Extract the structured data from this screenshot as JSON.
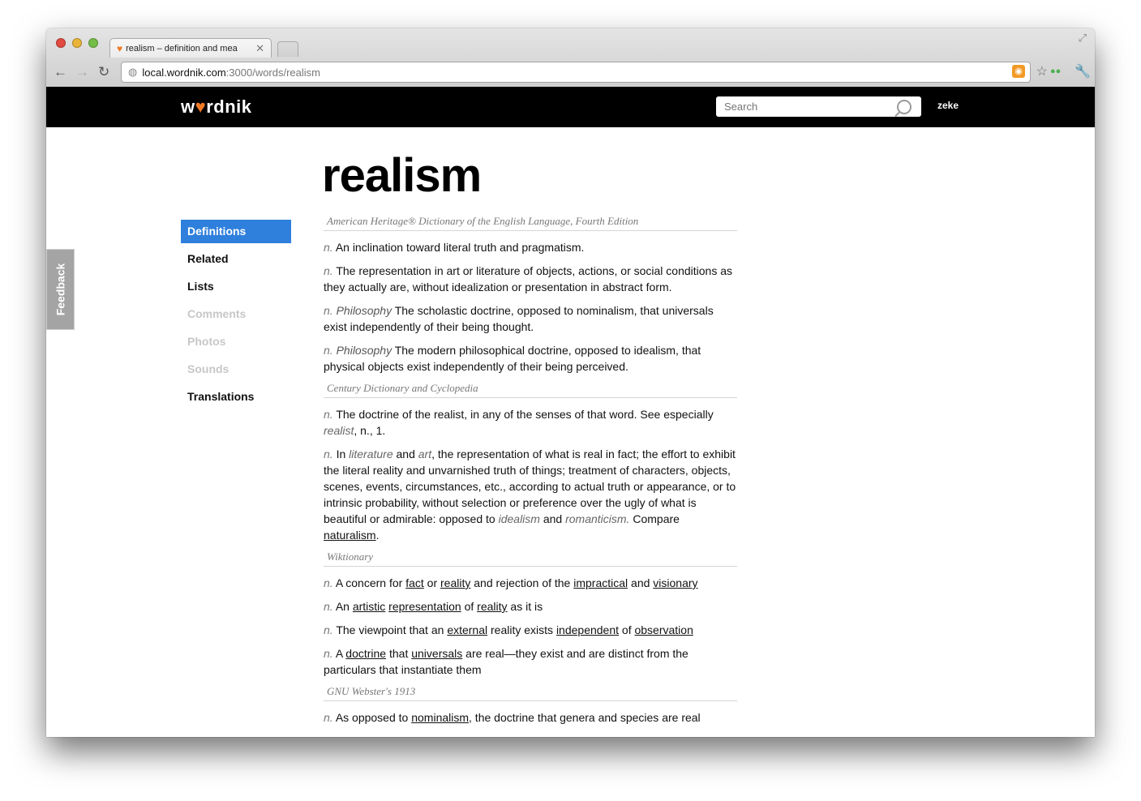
{
  "browser": {
    "tab_title": "realism – definition and mea",
    "url_host": "local.wordnik.com",
    "url_path": ":3000/words/realism"
  },
  "header": {
    "logo_pre": "w",
    "logo_post": "rdnik",
    "search_placeholder": "Search",
    "username": "zeke"
  },
  "feedback_label": "Feedback",
  "sidebar": {
    "items": [
      {
        "label": "Definitions"
      },
      {
        "label": "Related"
      },
      {
        "label": "Lists"
      },
      {
        "label": "Comments"
      },
      {
        "label": "Photos"
      },
      {
        "label": "Sounds"
      },
      {
        "label": "Translations"
      }
    ]
  },
  "word": "realism",
  "definitions": [
    {
      "source": "American Heritage® Dictionary of the English Language, Fourth Edition",
      "entries": [
        {
          "pos": "n.",
          "text": "An inclination toward literal truth and pragmatism."
        },
        {
          "pos": "n.",
          "text": "The representation in art or literature of objects, actions, or social conditions as they actually are, without idealization or presentation in abstract form."
        },
        {
          "pos": "n.",
          "label": "Philosophy",
          "text": "The scholastic doctrine, opposed to nominalism, that universals exist independently of their being thought."
        },
        {
          "pos": "n.",
          "label": "Philosophy",
          "text": "The modern philosophical doctrine, opposed to idealism, that physical objects exist independently of their being perceived."
        }
      ]
    },
    {
      "source": "Century Dictionary and Cyclopedia",
      "entries": [
        {
          "pos": "n.",
          "t1": "The doctrine of the realist, in any of the senses of that word. See especially",
          "i1": "realist",
          "t2": ", n., 1."
        },
        {
          "pos": "n.",
          "t1": "In",
          "i1": "literature",
          "t2": "and",
          "i2": "art",
          "t3": ", the representation of what is real in fact; the effort to exhibit the literal reality and unvarnished truth of things; treatment of characters, objects, scenes, events, circumstances, etc., according to actual truth or appearance, or to intrinsic probability, without selection or preference over the ugly of what is beautiful or admirable: opposed to",
          "i3": "idealism",
          "t4": "and",
          "i4": "romanticism.",
          "t5": "Compare",
          "l5": "naturalism",
          "t6": "."
        }
      ]
    },
    {
      "source": "Wiktionary",
      "entries": [
        {
          "pos": "n.",
          "t1": "A concern for",
          "l1": "fact",
          "t2": "or",
          "l2": "reality",
          "t3": "and rejection of the",
          "l3": "impractical",
          "t4": "and",
          "l4": "visionary"
        },
        {
          "pos": "n.",
          "t1": "An",
          "l1": "artistic",
          "l2": "representation",
          "t2": "of",
          "l3": "reality",
          "t3": "as it is"
        },
        {
          "pos": "n.",
          "t1": "The viewpoint that an",
          "l1": "external",
          "t2": "reality exists",
          "l2": "independent",
          "t3": "of",
          "l3": "observation"
        },
        {
          "pos": "n.",
          "t1": "A",
          "l1": "doctrine",
          "t2": "that",
          "l2": "universals",
          "t3": "are real—they exist and are distinct from the particulars that instantiate them"
        }
      ]
    },
    {
      "source": "GNU Webster's 1913",
      "entries": [
        {
          "pos": "n.",
          "t1": "As opposed to",
          "l1": "nominalism",
          "t2": ", the doctrine that genera and species are real"
        }
      ]
    }
  ]
}
